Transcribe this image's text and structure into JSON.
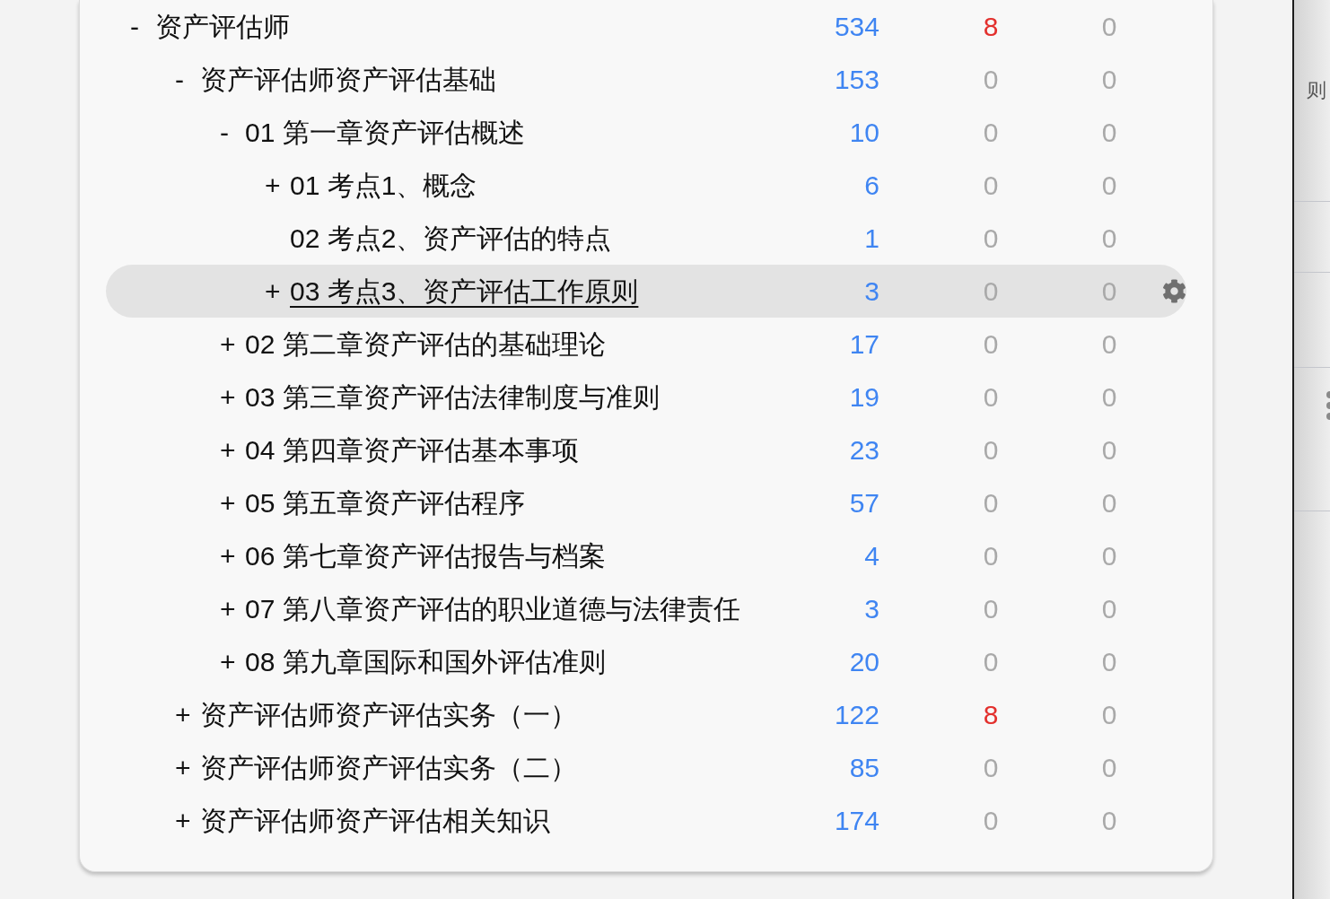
{
  "tree": [
    {
      "toggle": "-",
      "label": "资产评估师",
      "column_1": "534",
      "column_2": "8",
      "column_2_alert": true,
      "column_3": "0",
      "selected": false,
      "children": [
        {
          "toggle": "-",
          "label": "资产评估师资产评估基础",
          "column_1": "153",
          "column_2": "0",
          "column_2_alert": false,
          "column_3": "0",
          "selected": false,
          "children": [
            {
              "toggle": "-",
              "label": "01 第一章资产评估概述",
              "column_1": "10",
              "column_2": "0",
              "column_2_alert": false,
              "column_3": "0",
              "selected": false,
              "children": [
                {
                  "toggle": "+",
                  "label": "01 考点1、概念",
                  "column_1": "6",
                  "column_2": "0",
                  "column_2_alert": false,
                  "column_3": "0",
                  "selected": false
                },
                {
                  "label": "02 考点2、资产评估的特点",
                  "column_1": "1",
                  "column_2": "0",
                  "column_2_alert": false,
                  "column_3": "0",
                  "selected": false
                },
                {
                  "toggle": "+",
                  "label": "03 考点3、资产评估工作原则",
                  "column_1": "3",
                  "column_2": "0",
                  "column_2_alert": false,
                  "column_3": "0",
                  "selected": true
                }
              ]
            },
            {
              "toggle": "+",
              "label": "02 第二章资产评估的基础理论",
              "column_1": "17",
              "column_2": "0",
              "column_2_alert": false,
              "column_3": "0",
              "selected": false
            },
            {
              "toggle": "+",
              "label": "03 第三章资产评估法律制度与准则",
              "column_1": "19",
              "column_2": "0",
              "column_2_alert": false,
              "column_3": "0",
              "selected": false
            },
            {
              "toggle": "+",
              "label": "04 第四章资产评估基本事项",
              "column_1": "23",
              "column_2": "0",
              "column_2_alert": false,
              "column_3": "0",
              "selected": false
            },
            {
              "toggle": "+",
              "label": "05 第五章资产评估程序",
              "column_1": "57",
              "column_2": "0",
              "column_2_alert": false,
              "column_3": "0",
              "selected": false
            },
            {
              "toggle": "+",
              "label": "06 第七章资产评估报告与档案",
              "column_1": "4",
              "column_2": "0",
              "column_2_alert": false,
              "column_3": "0",
              "selected": false
            },
            {
              "toggle": "+",
              "label": "07 第八章资产评估的职业道德与法律责任",
              "column_1": "3",
              "column_2": "0",
              "column_2_alert": false,
              "column_3": "0",
              "selected": false
            },
            {
              "toggle": "+",
              "label": "08 第九章国际和国外评估准则",
              "column_1": "20",
              "column_2": "0",
              "column_2_alert": false,
              "column_3": "0",
              "selected": false
            }
          ]
        },
        {
          "toggle": "+",
          "label": "资产评估师资产评估实务（一）",
          "column_1": "122",
          "column_2": "8",
          "column_2_alert": true,
          "column_3": "0",
          "selected": false
        },
        {
          "toggle": "+",
          "label": "资产评估师资产评估实务（二）",
          "column_1": "85",
          "column_2": "0",
          "column_2_alert": false,
          "column_3": "0",
          "selected": false
        },
        {
          "toggle": "+",
          "label": "资产评估师资产评估相关知识",
          "column_1": "174",
          "column_2": "0",
          "column_2_alert": false,
          "column_3": "0",
          "selected": false
        }
      ]
    }
  ],
  "side_panel": {
    "text": "则"
  }
}
